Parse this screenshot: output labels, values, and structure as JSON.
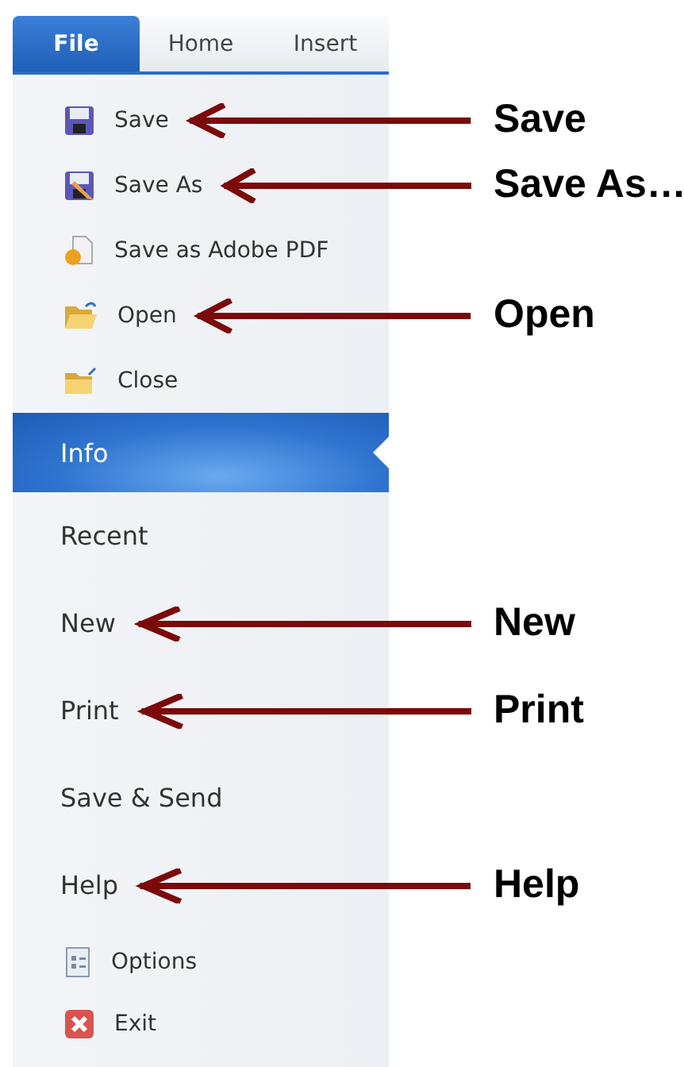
{
  "tabs": [
    {
      "label": "File",
      "selected": true
    },
    {
      "label": "Home",
      "selected": false
    },
    {
      "label": "Insert",
      "selected": false
    }
  ],
  "menu": [
    {
      "kind": "command",
      "label": "Save",
      "selected": false,
      "callout": "Save"
    },
    {
      "kind": "command",
      "label": "Save As",
      "selected": false,
      "callout": "Save As…"
    },
    {
      "kind": "command",
      "label": "Save as Adobe PDF",
      "selected": false
    },
    {
      "kind": "command",
      "label": "Open",
      "selected": false,
      "callout": "Open"
    },
    {
      "kind": "command",
      "label": "Close",
      "selected": false
    },
    {
      "kind": "page",
      "label": "Info",
      "selected": true
    },
    {
      "kind": "page",
      "label": "Recent",
      "selected": false
    },
    {
      "kind": "page",
      "label": "New",
      "selected": false,
      "callout": "New"
    },
    {
      "kind": "page",
      "label": "Print",
      "selected": false,
      "callout": "Print"
    },
    {
      "kind": "page",
      "label": "Save & Send",
      "selected": false
    },
    {
      "kind": "page",
      "label": "Help",
      "selected": false,
      "callout": "Help"
    },
    {
      "kind": "command",
      "label": "Options",
      "selected": false
    },
    {
      "kind": "command",
      "label": "Exit",
      "selected": false
    }
  ]
}
